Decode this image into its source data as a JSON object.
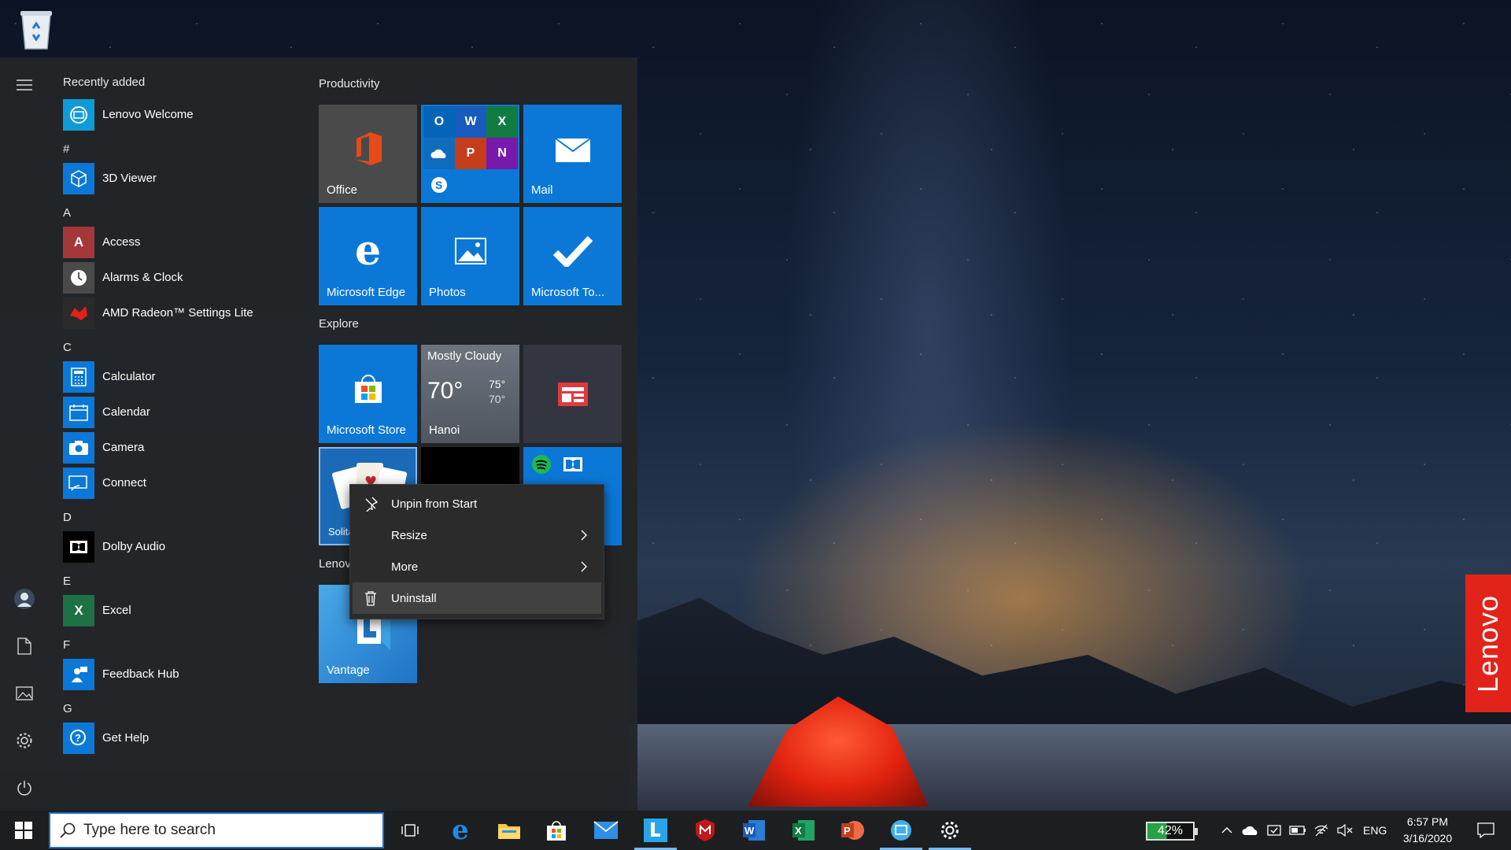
{
  "start_menu": {
    "rail": {
      "items": [
        {
          "name": "hamburger-menu-icon"
        },
        {
          "name": "user-avatar-icon"
        },
        {
          "name": "documents-icon"
        },
        {
          "name": "pictures-icon"
        },
        {
          "name": "settings-icon"
        },
        {
          "name": "power-icon"
        }
      ]
    },
    "app_list": {
      "recently_added_label": "Recently added",
      "recent_items": [
        {
          "label": "Lenovo Welcome",
          "icon": "lenovo-welcome-icon"
        }
      ],
      "groups": [
        {
          "letter": "#",
          "items": [
            {
              "label": "3D Viewer",
              "icon": "cube-icon"
            }
          ]
        },
        {
          "letter": "A",
          "items": [
            {
              "label": "Access",
              "icon": "access-icon"
            },
            {
              "label": "Alarms & Clock",
              "icon": "clock-icon"
            },
            {
              "label": "AMD Radeon™ Settings Lite",
              "icon": "amd-radeon-icon"
            }
          ]
        },
        {
          "letter": "C",
          "items": [
            {
              "label": "Calculator",
              "icon": "calculator-icon"
            },
            {
              "label": "Calendar",
              "icon": "calendar-icon"
            },
            {
              "label": "Camera",
              "icon": "camera-icon"
            },
            {
              "label": "Connect",
              "icon": "connect-icon"
            }
          ]
        },
        {
          "letter": "D",
          "items": [
            {
              "label": "Dolby Audio",
              "icon": "dolby-icon"
            }
          ]
        },
        {
          "letter": "E",
          "items": [
            {
              "label": "Excel",
              "icon": "excel-icon"
            }
          ]
        },
        {
          "letter": "F",
          "items": [
            {
              "label": "Feedback Hub",
              "icon": "feedback-hub-icon"
            }
          ]
        },
        {
          "letter": "G",
          "items": [
            {
              "label": "Get Help",
              "icon": "get-help-icon"
            }
          ]
        }
      ]
    },
    "tiles": {
      "productivity_title": "Productivity",
      "explore_title": "Explore",
      "lenovo_title": "Lenov",
      "office": "Office",
      "mail": "Mail",
      "edge": "Microsoft Edge",
      "photos": "Photos",
      "todo": "Microsoft To...",
      "store": "Microsoft Store",
      "weather": {
        "condition": "Mostly Cloudy",
        "temp": "70°",
        "high": "75°",
        "low": "70°",
        "city": "Hanoi"
      },
      "solitaire_partial": "Solita",
      "vantage": "Vantage"
    },
    "context_menu": {
      "items": [
        {
          "label": "Unpin from Start",
          "icon": "unpin-icon"
        },
        {
          "label": "Resize",
          "icon": "",
          "submenu": true
        },
        {
          "label": "More",
          "icon": "",
          "submenu": true
        },
        {
          "label": "Uninstall",
          "icon": "trash-icon",
          "active": true
        }
      ]
    }
  },
  "desktop": {
    "lenovo_brand": "Lenovo"
  },
  "taskbar": {
    "search_placeholder": "Type here to search",
    "pinned": [
      {
        "name": "task-view-icon"
      },
      {
        "name": "edge-icon"
      },
      {
        "name": "file-explorer-icon"
      },
      {
        "name": "store-icon"
      },
      {
        "name": "mail-icon"
      },
      {
        "name": "lenovo-vantage-icon",
        "running": true
      },
      {
        "name": "mcafee-icon"
      },
      {
        "name": "word-icon"
      },
      {
        "name": "excel-icon"
      },
      {
        "name": "powerpoint-icon"
      },
      {
        "name": "lenovo-welcome-icon",
        "running": true
      },
      {
        "name": "settings-icon",
        "running": true
      }
    ],
    "battery_text": "42%",
    "battery_level": 0.42,
    "language": "ENG",
    "time": "6:57 PM",
    "date": "3/16/2020"
  }
}
